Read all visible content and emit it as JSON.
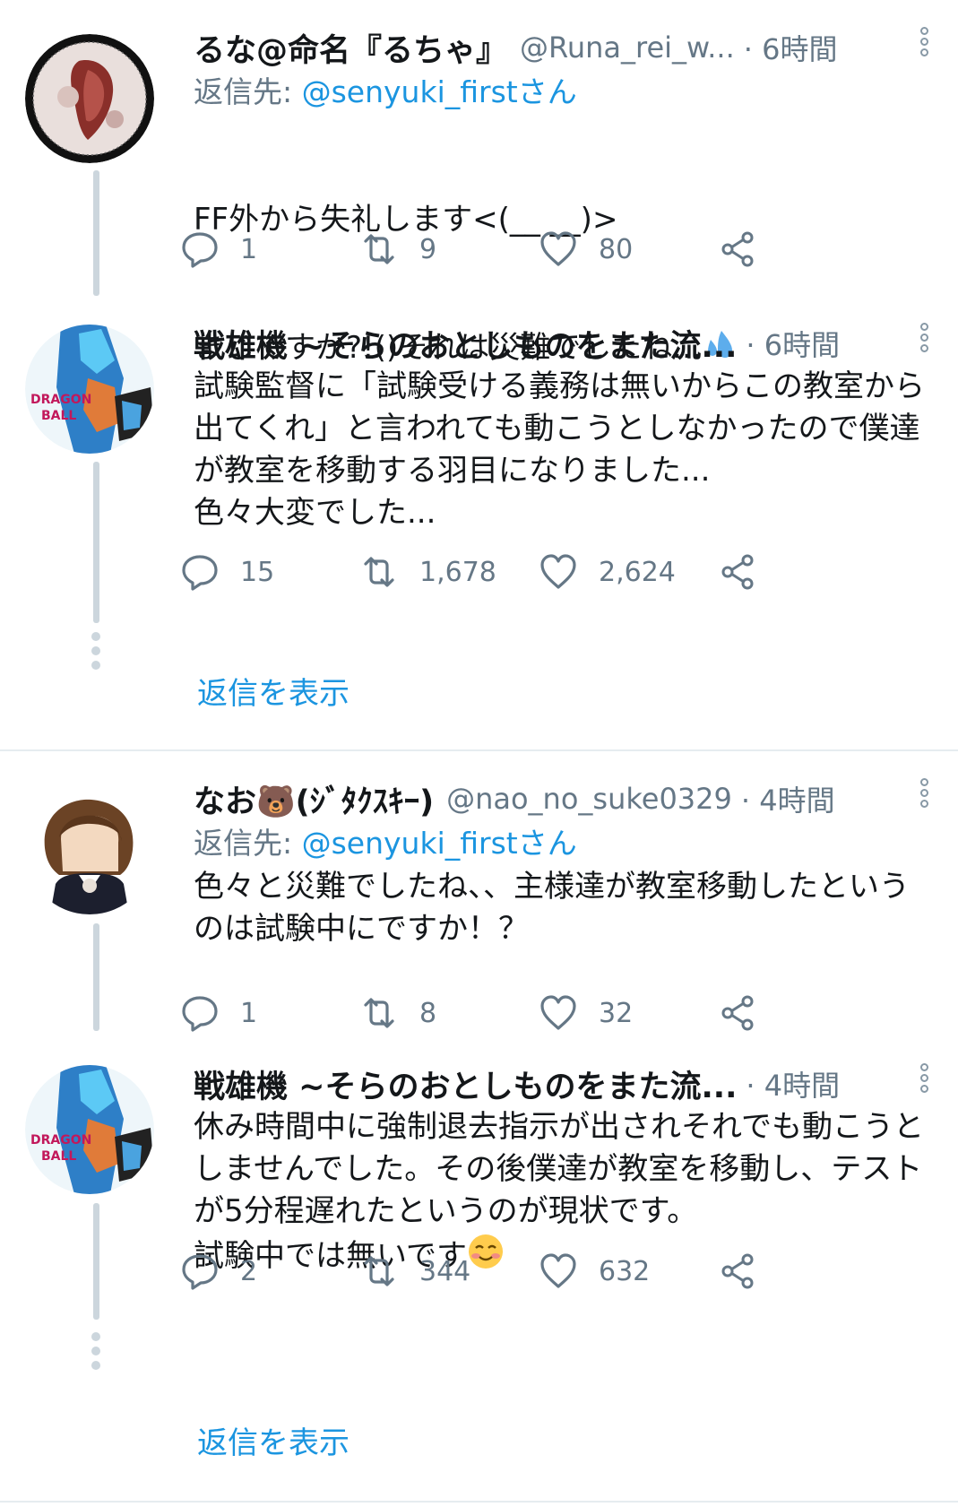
{
  "accent": "#1b95e0",
  "threads": [
    {
      "tweets": [
        {
          "name": "るな@命名『るちゃ』",
          "handle": "@Runa_rei_w...",
          "time": "· 6時間",
          "reply_prefix": "返信先: ",
          "reply_to": "@senyuki_firstさん",
          "text_line1": "FF外から失礼します<(__ __)>",
          "text_line2": "まじですか?!()それは災難でしたね...",
          "emoji": "sweat-droplets-icon",
          "counts": {
            "reply": "1",
            "retweet": "9",
            "like": "80"
          }
        },
        {
          "name": "戦雄機 ~そらのおとしものをまた流...",
          "handle": "",
          "time": "· 6時間",
          "text": "試験監督に「試験受ける義務は無いからこの教室から出てくれ」と言われても動こうとしなかったので僕達が教室を移動する羽目になりました...\n色々大変でした...",
          "counts": {
            "reply": "15",
            "retweet": "1,678",
            "like": "2,624"
          }
        }
      ],
      "show_replies": "返信を表示"
    },
    {
      "tweets": [
        {
          "name": "なお🐻(ｼﾞﾀｸｽｷｰ)",
          "handle": "@nao_no_suke0329",
          "time": "· 4時間",
          "reply_prefix": "返信先: ",
          "reply_to": "@senyuki_firstさん",
          "text": "色々と災難でしたね、、主様達が教室移動したというのは試験中にですか！？",
          "counts": {
            "reply": "1",
            "retweet": "8",
            "like": "32"
          }
        },
        {
          "name": "戦雄機 ~そらのおとしものをまた流...",
          "handle": "",
          "time": "· 4時間",
          "text_main": "休み時間中に強制退去指示が出されそれでも動こうとしませんでした。その後僕達が教室を移動し、テストが5分程遅れたというのが現状です。\n試験中では無いです",
          "emoji": "smiling-blush-icon",
          "counts": {
            "reply": "2",
            "retweet": "344",
            "like": "632"
          }
        }
      ],
      "show_replies": "返信を表示"
    }
  ]
}
